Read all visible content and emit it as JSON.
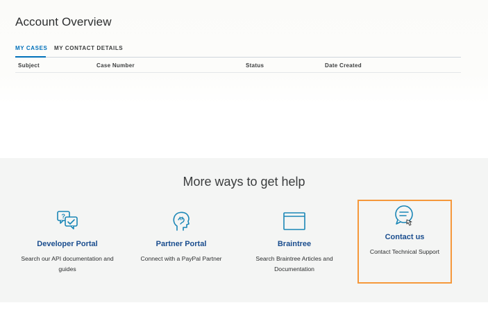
{
  "page": {
    "title": "Account Overview"
  },
  "tabs": [
    {
      "label": "MY CASES",
      "active": true
    },
    {
      "label": "MY CONTACT DETAILS",
      "active": false
    }
  ],
  "cases_table": {
    "columns": [
      "Subject",
      "Case Number",
      "Status",
      "Date Created"
    ],
    "rows": []
  },
  "help_section": {
    "title": "More ways to get help",
    "cards": [
      {
        "label": "Developer Portal",
        "description": "Search our API documentation and guides",
        "icon": "chat-bubbles-icon"
      },
      {
        "label": "Partner Portal",
        "description": "Connect with a PayPal Partner",
        "icon": "partner-head-icon"
      },
      {
        "label": "Braintree",
        "description": "Search Braintree Articles and Documentation",
        "icon": "browser-window-icon"
      },
      {
        "label": "Contact us",
        "description": "Contact Technical Support",
        "icon": "contact-chat-icon",
        "highlighted": true
      }
    ]
  },
  "colors": {
    "link_blue": "#0070ba",
    "card_title_blue": "#1a4d8e",
    "icon_teal": "#1a86b6",
    "highlight_orange": "#f5983a",
    "help_bg": "#f4f5f4"
  }
}
